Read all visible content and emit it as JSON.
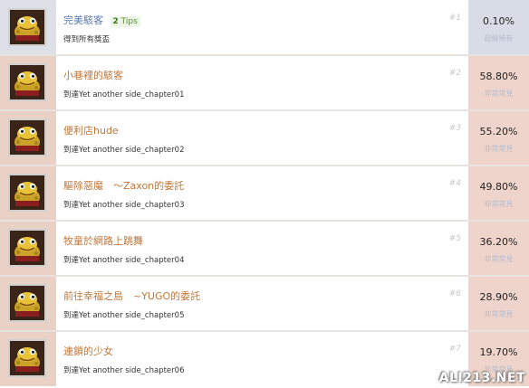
{
  "colors": {
    "first_left": "#dde0e6",
    "first_right": "#d8dce6",
    "row_left": "#e9d1c6",
    "row_right": "#eed4ca",
    "title_first": "#5a7bb0",
    "title_rest": "#c0773a"
  },
  "achievements": [
    {
      "title": "完美駭客",
      "tips": "2",
      "tips_label": "Tips",
      "description": "得到所有獎盃",
      "number": "#1",
      "percent": "0.10%",
      "label": "超級稀有",
      "icon": "trophy-toad-icon"
    },
    {
      "title": "小巷裡的駭客",
      "description": "到達Yet another side_chapter01",
      "number": "#2",
      "percent": "58.80%",
      "label": "非常常見",
      "icon": "trophy-toad-icon"
    },
    {
      "title": "便利店hude",
      "description": "到達Yet another side_chapter02",
      "number": "#3",
      "percent": "55.20%",
      "label": "非常常見",
      "icon": "trophy-toad-icon"
    },
    {
      "title": "驅除惡魔　～Zaxon的委託",
      "description": "到達Yet another side_chapter03",
      "number": "#4",
      "percent": "49.80%",
      "label": "非常常見",
      "icon": "trophy-toad-icon"
    },
    {
      "title": "牧童於網路上跳舞",
      "description": "到達Yet another side_chapter04",
      "number": "#5",
      "percent": "36.20%",
      "label": "非常常見",
      "icon": "trophy-toad-icon"
    },
    {
      "title": "前往幸福之島　~YUGO的委託",
      "description": "到達Yet another side_chapter05",
      "number": "#6",
      "percent": "28.90%",
      "label": "非常常見",
      "icon": "trophy-toad-icon"
    },
    {
      "title": "連鎖的少女",
      "description": "到達Yet another side_chapter06",
      "number": "#7",
      "percent": "19.70%",
      "label": "非常常見",
      "icon": "trophy-toad-icon"
    }
  ],
  "watermark": "ALI213.NET"
}
